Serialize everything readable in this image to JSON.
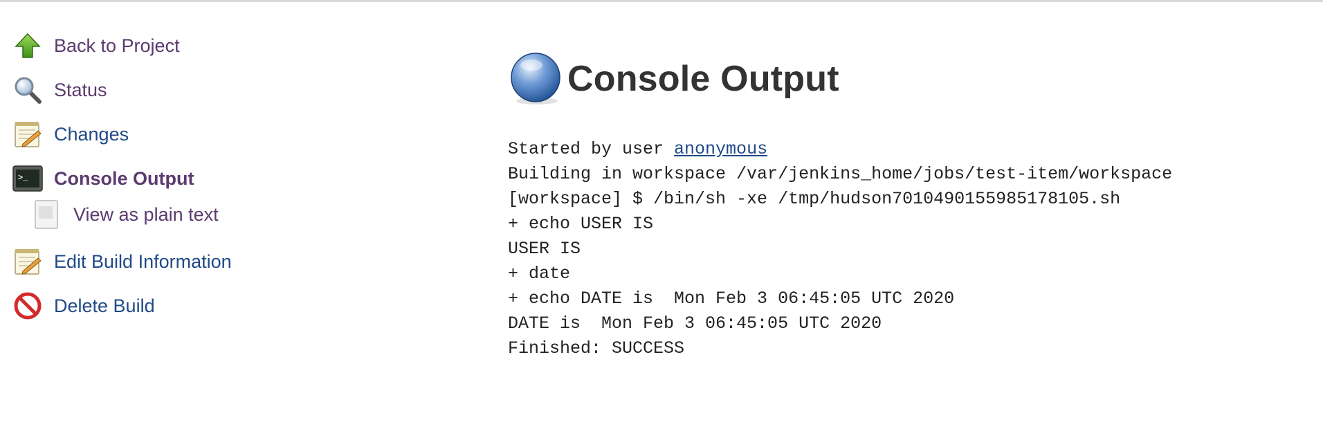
{
  "sidebar": {
    "items": [
      {
        "label": "Back to Project",
        "icon": "up-arrow-icon"
      },
      {
        "label": "Status",
        "icon": "magnifier-icon"
      },
      {
        "label": "Changes",
        "icon": "notepad-icon"
      },
      {
        "label": "Console Output",
        "icon": "terminal-icon",
        "current": true
      },
      {
        "label": "View as plain text",
        "icon": "document-icon",
        "sub": true
      },
      {
        "label": "Edit Build Information",
        "icon": "notepad-icon"
      },
      {
        "label": "Delete Build",
        "icon": "no-entry-icon"
      }
    ]
  },
  "main": {
    "title": "Console Output",
    "status_icon": "blue-ball-icon",
    "console": {
      "started_prefix": "Started by user ",
      "user_link": "anonymous",
      "lines": [
        "Building in workspace /var/jenkins_home/jobs/test-item/workspace",
        "[workspace] $ /bin/sh -xe /tmp/hudson7010490155985178105.sh",
        "+ echo USER IS",
        "USER IS",
        "+ date",
        "+ echo DATE is  Mon Feb 3 06:45:05 UTC 2020",
        "DATE is  Mon Feb 3 06:45:05 UTC 2020",
        "Finished: SUCCESS"
      ]
    }
  },
  "colors": {
    "link_visited": "#5b3a6e",
    "link": "#204a87",
    "title": "#333333",
    "success_ball": "#3f6fb5"
  }
}
